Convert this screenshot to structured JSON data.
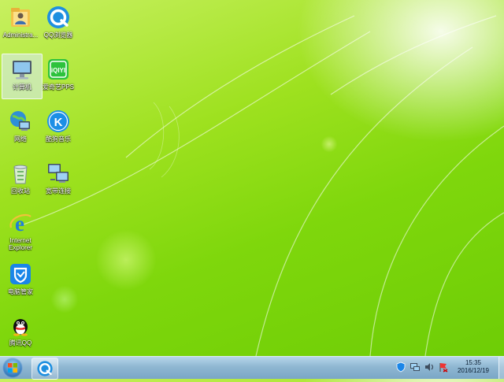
{
  "desktop": {
    "icons": [
      {
        "label": "Administra...",
        "icon": "user-folder-icon"
      },
      {
        "label": "QQ浏览器",
        "icon": "qq-browser-icon"
      },
      {
        "label": "计算机",
        "icon": "computer-icon",
        "selected": true
      },
      {
        "label": "爱奇艺PPS",
        "icon": "iqiyi-icon"
      },
      {
        "label": "网络",
        "icon": "network-icon"
      },
      {
        "label": "酷狗音乐",
        "icon": "kugou-music-icon"
      },
      {
        "label": "回收站",
        "icon": "recycle-bin-icon"
      },
      {
        "label": "宽带连接",
        "icon": "broadband-connection-icon"
      },
      {
        "label": "Internet Explorer",
        "icon": "internet-explorer-icon"
      },
      {
        "label": "电脑管家",
        "icon": "pc-manager-icon"
      },
      {
        "label": "腾讯QQ",
        "icon": "tencent-qq-icon"
      }
    ]
  },
  "taskbar": {
    "start_icon": "windows-start-icon",
    "pinned": [
      {
        "icon": "qq-browser-icon"
      }
    ],
    "tray_icons": [
      "security-shield-icon",
      "network-tray-icon",
      "volume-icon",
      "flag-icon"
    ],
    "time": "15:35",
    "date": "2016/12/19"
  },
  "colors": {
    "wallpaper": "#8fdc18",
    "taskbar": "#9dc3dc"
  }
}
